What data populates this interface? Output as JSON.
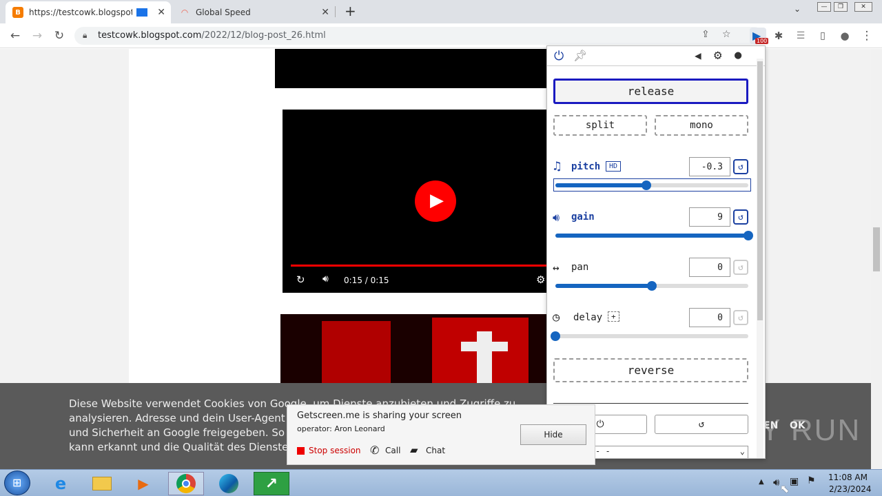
{
  "browser": {
    "tabs": [
      {
        "title": "https://testcowk.blogspot.co",
        "favicon": "blogger-icon"
      },
      {
        "title": "Global Speed",
        "favicon": "global-speed-icon"
      }
    ],
    "url_host": "testcowk.blogspot.com",
    "url_path": "/2022/12/blog-post_26.html",
    "extension_badge": "100"
  },
  "video": {
    "time": "0:15 / 0:15",
    "progress": 1.0
  },
  "cookie_text": "Diese Website verwendet Cookies von Google, um Dienste anzubieten und Zugriffe zu analysieren. Adresse und dein User-Agent werden zusammen mit Messwerten zur Leistung und Sicherheit an Google freigegeben. So können Nutzungsstatistiken generiert, Missbrauch kann erkannt und die Qualität des Dienstes gewährleistet werden.",
  "cookie_buttons": {
    "more": "EN",
    "ok": "OK"
  },
  "extension": {
    "release": "release",
    "split": "split",
    "mono": "mono",
    "pitch": {
      "label": "pitch",
      "badge": "HD",
      "value": "-0.3",
      "level": 0.47
    },
    "gain": {
      "label": "gain",
      "value": "9",
      "level": 1.0
    },
    "pan": {
      "label": "pan",
      "value": "0",
      "level": 0.5
    },
    "delay": {
      "label": "delay",
      "plus": "+",
      "value": "0",
      "level": 0.0
    },
    "reverse": "reverse",
    "select_value": "- -"
  },
  "share": {
    "title": "Getscreen.me is sharing your screen",
    "operator": "operator: Aron Leonard",
    "hide": "Hide",
    "stop": "Stop session",
    "call": "Call",
    "chat": "Chat"
  },
  "watermark": "ANY RUN",
  "clock": {
    "time": "11:08 AM",
    "date": "2/23/2024"
  }
}
